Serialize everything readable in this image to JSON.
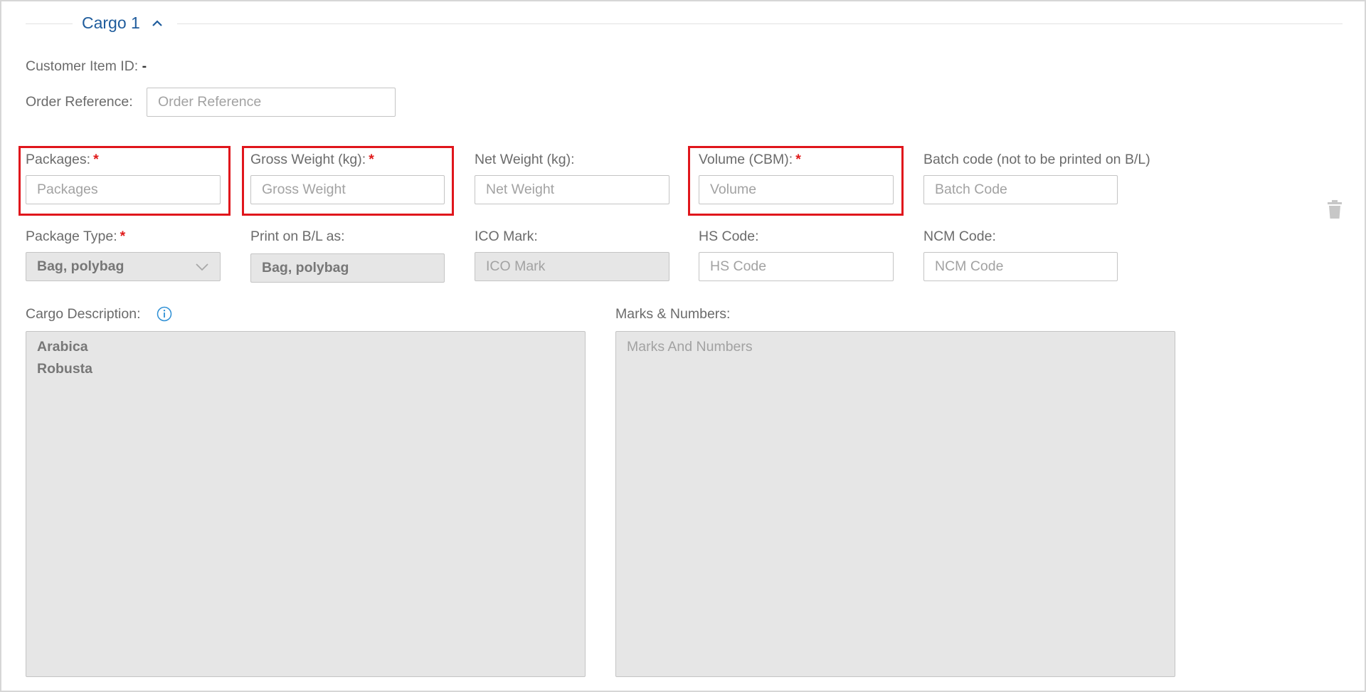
{
  "section": {
    "title": "Cargo 1",
    "toggle_icon": "chevron-up-icon"
  },
  "customer_item": {
    "label": "Customer Item ID:",
    "value": "-"
  },
  "order_reference": {
    "label": "Order Reference:",
    "placeholder": "Order Reference",
    "value": ""
  },
  "fields_row1": {
    "packages": {
      "label": "Packages:",
      "required": "*",
      "placeholder": "Packages"
    },
    "gross_weight": {
      "label": "Gross Weight (kg):",
      "required": "*",
      "placeholder": "Gross Weight"
    },
    "net_weight": {
      "label": "Net Weight (kg):",
      "placeholder": "Net Weight"
    },
    "volume": {
      "label": "Volume (CBM):",
      "required": "*",
      "placeholder": "Volume"
    },
    "batch_code": {
      "label": "Batch code (not to be printed on B/L)",
      "placeholder": "Batch Code"
    }
  },
  "fields_row2": {
    "package_type": {
      "label": "Package Type:",
      "required": "*",
      "value": "Bag, polybag"
    },
    "print_on_bl": {
      "label": "Print on B/L as:",
      "value": "Bag, polybag"
    },
    "ico_mark": {
      "label": "ICO Mark:",
      "placeholder": "ICO Mark"
    },
    "hs_code": {
      "label": "HS Code:",
      "placeholder": "HS Code"
    },
    "ncm_code": {
      "label": "NCM Code:",
      "placeholder": "NCM Code"
    }
  },
  "cargo_description": {
    "label": "Cargo Description:",
    "value": "Arabica\nRobusta",
    "info_icon": "info-icon"
  },
  "marks_numbers": {
    "label": "Marks & Numbers:",
    "placeholder": "Marks And Numbers"
  },
  "delete_icon": "trash-icon",
  "colors": {
    "accent": "#1f5c9c",
    "required": "#e01b1b",
    "highlight": "#e0161c",
    "disabled_bg": "#e6e6e6"
  }
}
